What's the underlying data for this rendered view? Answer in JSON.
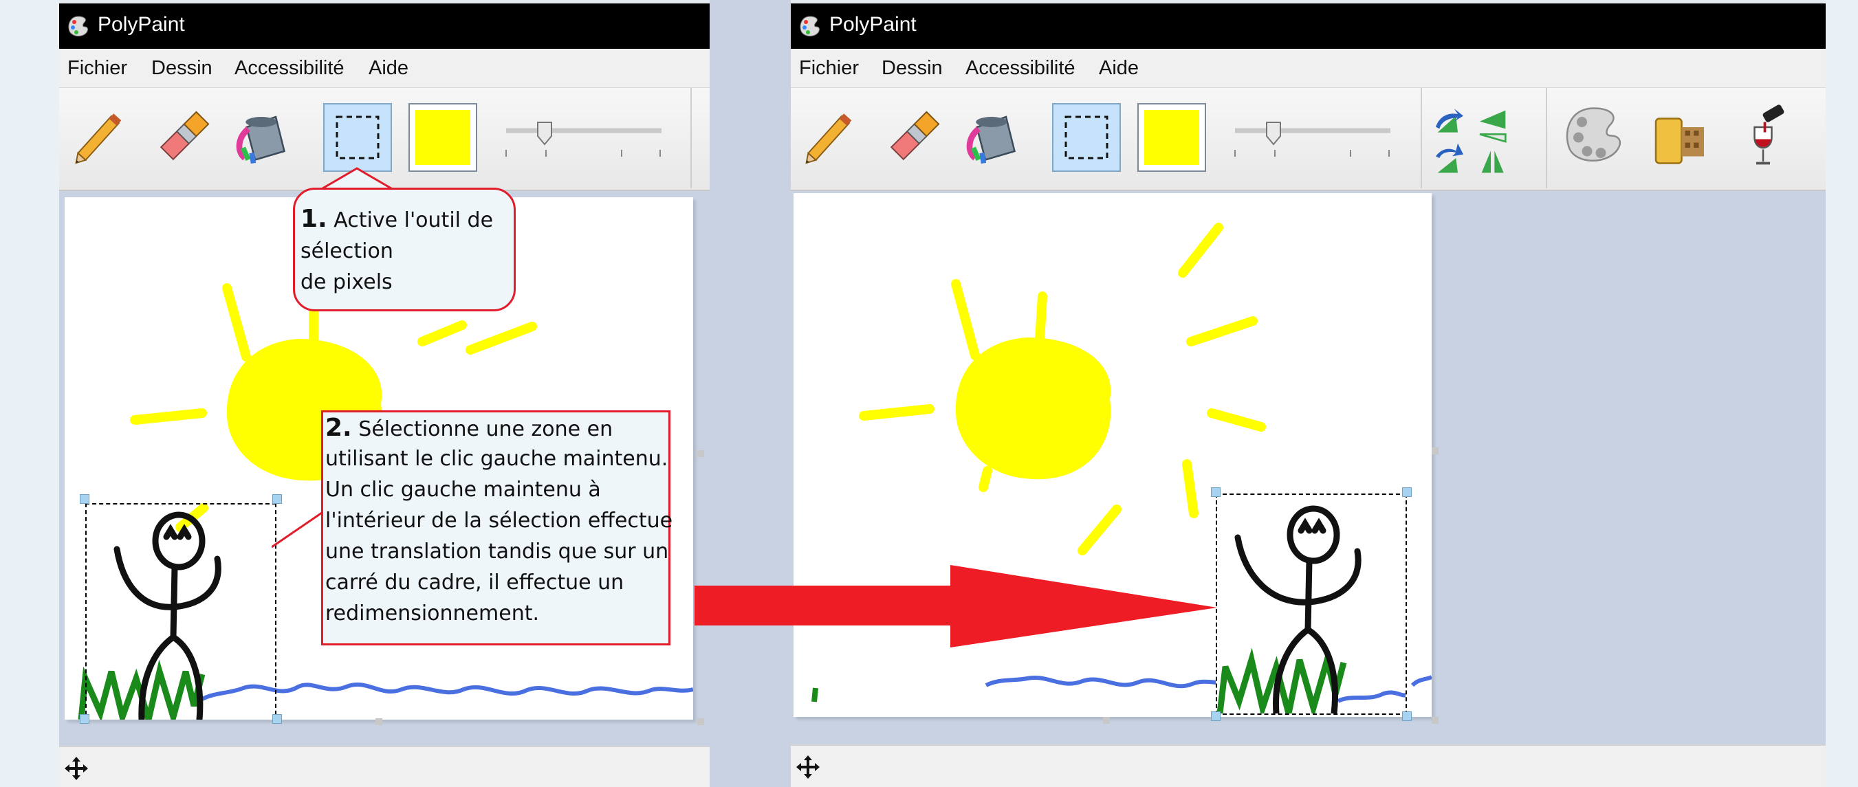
{
  "left_window": {
    "title": "PolyPaint",
    "menu": [
      "Fichier",
      "Dessin",
      "Accessibilité",
      "Aide"
    ],
    "tools": [
      "pencil",
      "eraser",
      "paint-bucket",
      "selection",
      "color-swatch"
    ]
  },
  "right_window": {
    "title": "PolyPaint",
    "menu": [
      "Fichier",
      "Dessin",
      "Accessibilité",
      "Aide"
    ],
    "tools": [
      "pencil",
      "eraser",
      "paint-bucket",
      "selection",
      "color-swatch",
      "rotate-flip-tools",
      "palette",
      "film",
      "wine-glass"
    ]
  },
  "callout1": {
    "number": "1.",
    "line1": " Active l'outil de",
    "line2": "sélection",
    "line3": "de pixels"
  },
  "callout2": {
    "number": "2.",
    "line1": " Sélectionne une zone en",
    "line2": "utilisant le clic gauche maintenu.",
    "line3": "Un clic gauche maintenu à",
    "line4": "l'intérieur de la sélection effectue",
    "line5": "une translation tandis que sur un",
    "line6": "carré du cadre, il effectue un",
    "line7": "redimensionnement."
  },
  "colors": {
    "accent": "#e11d2b",
    "selected_tool": "#c7e3fb",
    "swatch": "#ffff00",
    "sun": "#ffff00",
    "grass": "#1a8a1a",
    "water": "#4a6fe0"
  }
}
